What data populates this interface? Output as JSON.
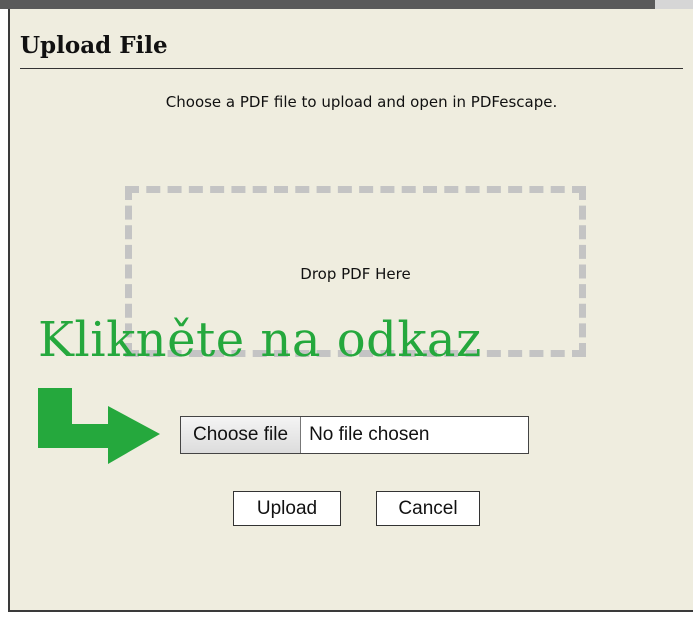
{
  "dialog": {
    "title": "Upload File",
    "subtitle": "Choose a PDF file to upload and open in PDFescape.",
    "dropzone_label": "Drop PDF Here"
  },
  "annotation": {
    "text": "Klikněte na odkaz",
    "color": "#25a83d"
  },
  "file_input": {
    "button_label": "Choose file",
    "status": "No file chosen"
  },
  "actions": {
    "upload_label": "Upload",
    "cancel_label": "Cancel"
  },
  "colors": {
    "dialog_bg": "#efeddf",
    "dropzone_border": "#c4c4c4",
    "annotation_green": "#25a83d"
  },
  "icons": {
    "arrow": "arrow-right-icon"
  }
}
